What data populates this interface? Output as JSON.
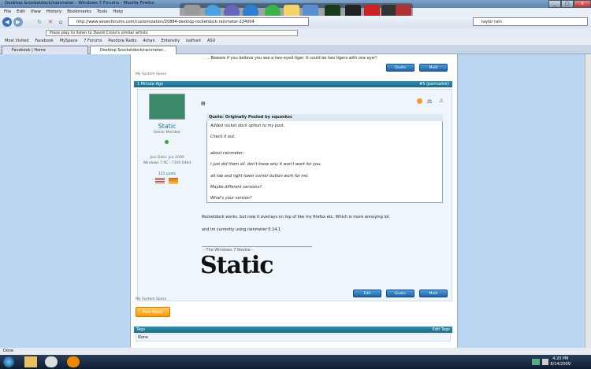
{
  "window": {
    "title": "Desktop &rocketdock/rainmeter - Windows 7 Forums - Mozilla Firefox",
    "buttons": [
      "_",
      "□",
      "x"
    ]
  },
  "menu": [
    "File",
    "Edit",
    "View",
    "History",
    "Bookmarks",
    "Tools",
    "Help"
  ],
  "nav": {
    "url": "http://www.sevenforums.com/customization/20884-desktop-rocketdock-rainmeter-224004",
    "search": "taylor rain"
  },
  "infobar": {
    "placeholder": "Press play to listen to David Cross's similar artists"
  },
  "bookmarks": [
    "Most Visited",
    "Facebook",
    "MySpace",
    "7 Forums",
    "Pandora Radio",
    "4chan",
    "Entensity",
    "isoHunt",
    "ASU"
  ],
  "tabs": [
    "Facebook | Home",
    "Desktop &rocketdock/rainmeter..."
  ],
  "prev_post": {
    "text": ". . . Beware if you believe you see a two-eyed tiger.",
    "text2": "It could be two tigers with one eye!!",
    "sysspecs": "My System Specs",
    "quote": "Quote",
    "multi": "Multi"
  },
  "post": {
    "time": "1 Minute Ago",
    "permalink": "#5 (permalink)",
    "user": "Static",
    "rank": "Senior Member",
    "joined": "Join Date: Jun 2009",
    "os": "Windows 7 RC - 7100 64bit",
    "posts": "111 posts",
    "quote_header": "Quote: Originally Posted by squonksc",
    "quote_lines": [
      "Added rocket dock option to my post.",
      "Check it out.",
      "about rainmeter:",
      "I just did them all. don't know why it won't work for you.",
      "alt tab and right lower corner button work for me.",
      "Maybe different versions?",
      "What's your version?"
    ],
    "body": [
      "Rocketdock works. but now it overlays on top of like my firefox etc. Which is more annoying lol.",
      "and Im currently using rainmeter 0.14.1"
    ],
    "sig_rookie": "- The Windows 7 Rookie -",
    "sig_name": "Static",
    "sysspecs": "My System Specs",
    "edit": "Edit",
    "quote": "Quote",
    "multi": "Multi"
  },
  "post_reply": "Post Reply",
  "tags": {
    "label": "Tags",
    "edit": "Edit Tags",
    "value": "None"
  },
  "status": "Done",
  "clock": {
    "time": "4:20 PM",
    "date": "8/14/2009"
  }
}
